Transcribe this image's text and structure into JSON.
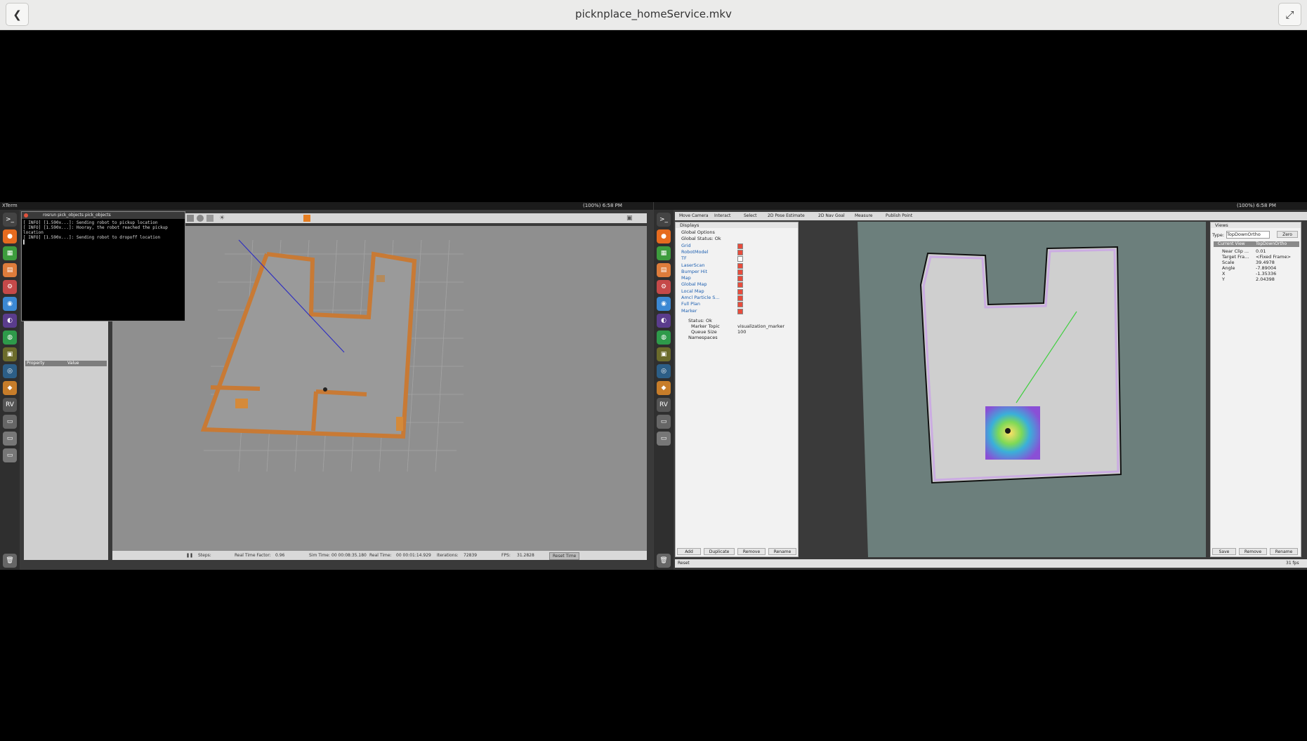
{
  "window": {
    "title": "picknplace_homeService.mkv"
  },
  "gazebo": {
    "topbar_left": "XTerm",
    "topbar_right": "(100%)  6:58 PM",
    "xterm_title": "rosrun pick_objects pick_objects",
    "xterm_lines": [
      "[ INFO] [1.590x...]: Sending robot to pickup location",
      "[ INFO] [1.590x...]: Hooray, the robot reached the pickup location",
      "[ INFO] [1.590x...]: Sending robot to dropoff location"
    ],
    "table_headers": [
      "Property",
      "Value"
    ],
    "status": {
      "steps_label": "Steps:",
      "rtf_label": "Real Time Factor:",
      "rtf_value": "0.96",
      "sim_label": "Sim Time:",
      "sim_value": "00 00:08:35.180",
      "real_label": "Real Time:",
      "real_value": "00 00:01:14.929",
      "iter_label": "Iterations:",
      "iter_value": "72839",
      "fps_label": "FPS:",
      "fps_value": "31.2828",
      "reset_label": "Reset Time"
    }
  },
  "rviz": {
    "topbar_right": "(100%)  6:58 PM",
    "toolbar": [
      "Move Camera",
      "Interact",
      "Select",
      "2D Pose Estimate",
      "2D Nav Goal",
      "Measure",
      "Publish Point"
    ],
    "displays_title": "Displays",
    "display_items": [
      {
        "label": "Global Options",
        "checked": false
      },
      {
        "label": "Global Status: Ok",
        "checked": false
      },
      {
        "label": "Grid",
        "checked": true
      },
      {
        "label": "RobotModel",
        "checked": true
      },
      {
        "label": "TF",
        "checked": false
      },
      {
        "label": "LaserScan",
        "checked": true
      },
      {
        "label": "Bumper Hit",
        "checked": true
      },
      {
        "label": "Map",
        "checked": true
      },
      {
        "label": "Global Map",
        "checked": true
      },
      {
        "label": "Local Map",
        "checked": true
      },
      {
        "label": "Amcl Particle S...",
        "checked": true
      },
      {
        "label": "Full Plan",
        "checked": true
      },
      {
        "label": "Marker",
        "checked": true
      }
    ],
    "marker_props": [
      {
        "k": "Status: Ok",
        "v": ""
      },
      {
        "k": "Marker Topic",
        "v": "visualization_marker"
      },
      {
        "k": "Queue Size",
        "v": "100"
      },
      {
        "k": "Namespaces",
        "v": ""
      }
    ],
    "display_buttons": [
      "Add",
      "Duplicate",
      "Remove",
      "Rename"
    ],
    "views_title": "Views",
    "views_type_label": "Type:",
    "views_type_value": "TopDownOrtho",
    "views_zero": "Zero",
    "current_view": [
      "Current View",
      "TopDownOrtho"
    ],
    "view_props": [
      {
        "k": "Near Clip ...",
        "v": "0.01"
      },
      {
        "k": "Target Fra...",
        "v": "<Fixed Frame>"
      },
      {
        "k": "Scale",
        "v": "39.4978"
      },
      {
        "k": "Angle",
        "v": "-7.89004"
      },
      {
        "k": "X",
        "v": "-1.35336"
      },
      {
        "k": "Y",
        "v": "2.04398"
      }
    ],
    "view_buttons": [
      "Save",
      "Remove",
      "Rename"
    ],
    "status_reset": "Reset",
    "fps": "31 fps"
  }
}
